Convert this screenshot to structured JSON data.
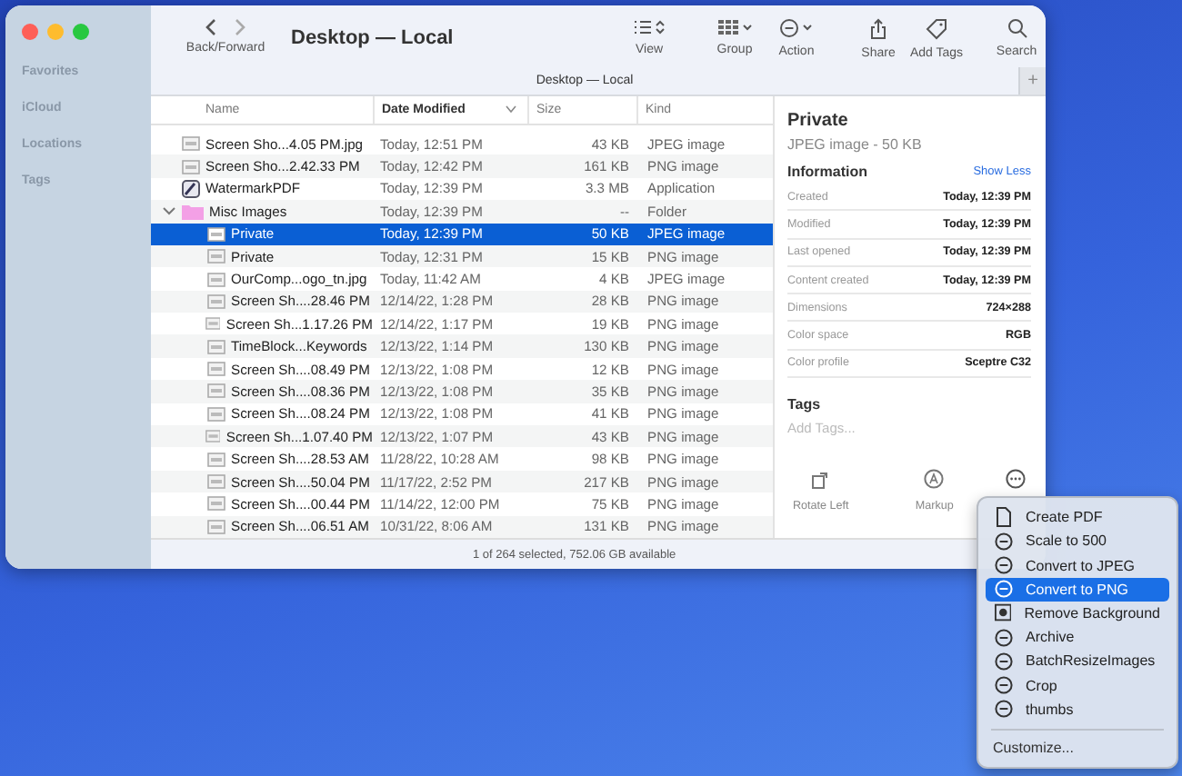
{
  "sidebar": {
    "items": [
      {
        "label": "Favorites"
      },
      {
        "label": "iCloud"
      },
      {
        "label": "Locations"
      },
      {
        "label": "Tags"
      }
    ]
  },
  "toolbar": {
    "nav_label": "Back/Forward",
    "title": "Desktop — Local",
    "items": [
      {
        "label": "View"
      },
      {
        "label": "Group"
      },
      {
        "label": "Action"
      },
      {
        "label": "Share"
      },
      {
        "label": "Add Tags"
      },
      {
        "label": "Search"
      }
    ]
  },
  "tab_bar": {
    "tab": "Desktop — Local",
    "add_button": "+"
  },
  "table": {
    "columns": [
      {
        "label": "Name",
        "sorted": false
      },
      {
        "label": "Date Modified",
        "sorted": true
      },
      {
        "label": "Size",
        "sorted": false
      },
      {
        "label": "Kind",
        "sorted": false
      }
    ],
    "rows": [
      {
        "kind": "file",
        "name": "Screen Sho...4.05 PM.jpg",
        "date": "Today, 12:51 PM",
        "size": "43 KB",
        "type": "JPEG image",
        "selected": false
      },
      {
        "kind": "file",
        "name": "Screen Sho...2.42.33 PM",
        "date": "Today, 12:42 PM",
        "size": "161 KB",
        "type": "PNG image",
        "selected": false
      },
      {
        "kind": "app",
        "name": "WatermarkPDF",
        "date": "Today, 12:39 PM",
        "size": "3.3 MB",
        "type": "Application",
        "selected": false
      },
      {
        "kind": "folder",
        "name": "Misc Images",
        "date": "Today, 12:39 PM",
        "size": "--",
        "type": "Folder",
        "selected": false,
        "expanded": true,
        "children": [
          {
            "kind": "file",
            "name": "Private",
            "date": "Today, 12:39 PM",
            "size": "50 KB",
            "type": "JPEG image",
            "selected": true
          },
          {
            "kind": "file",
            "name": "Private",
            "date": "Today, 12:31 PM",
            "size": "15 KB",
            "type": "PNG image",
            "selected": false
          },
          {
            "kind": "file",
            "name": "OurComp...ogo_tn.jpg",
            "date": "Today, 11:42 AM",
            "size": "4 KB",
            "type": "JPEG image",
            "selected": false
          },
          {
            "kind": "file",
            "name": "Screen Sh....28.46 PM",
            "date": "12/14/22, 1:28 PM",
            "size": "28 KB",
            "type": "PNG image",
            "selected": false
          },
          {
            "kind": "file",
            "name": "Screen Sh...1.17.26 PM",
            "date": "12/14/22, 1:17 PM",
            "size": "19 KB",
            "type": "PNG image",
            "selected": false
          },
          {
            "kind": "file",
            "name": "TimeBlock...Keywords",
            "date": "12/13/22, 1:14 PM",
            "size": "130 KB",
            "type": "PNG image",
            "selected": false
          },
          {
            "kind": "file",
            "name": "Screen Sh....08.49 PM",
            "date": "12/13/22, 1:08 PM",
            "size": "12 KB",
            "type": "PNG image",
            "selected": false
          },
          {
            "kind": "file",
            "name": "Screen Sh....08.36 PM",
            "date": "12/13/22, 1:08 PM",
            "size": "35 KB",
            "type": "PNG image",
            "selected": false
          },
          {
            "kind": "file",
            "name": "Screen Sh....08.24 PM",
            "date": "12/13/22, 1:08 PM",
            "size": "41 KB",
            "type": "PNG image",
            "selected": false
          },
          {
            "kind": "file",
            "name": "Screen Sh...1.07.40 PM",
            "date": "12/13/22, 1:07 PM",
            "size": "43 KB",
            "type": "PNG image",
            "selected": false
          },
          {
            "kind": "file",
            "name": "Screen Sh....28.53 AM",
            "date": "11/28/22, 10:28 AM",
            "size": "98 KB",
            "type": "PNG image",
            "selected": false
          },
          {
            "kind": "file",
            "name": "Screen Sh....50.04 PM",
            "date": "11/17/22, 2:52 PM",
            "size": "217 KB",
            "type": "PNG image",
            "selected": false
          },
          {
            "kind": "file",
            "name": "Screen Sh....00.44 PM",
            "date": "11/14/22, 12:00 PM",
            "size": "75 KB",
            "type": "PNG image",
            "selected": false
          },
          {
            "kind": "file",
            "name": "Screen Sh....06.51 AM",
            "date": "10/31/22, 8:06 AM",
            "size": "131 KB",
            "type": "PNG image",
            "selected": false
          }
        ]
      }
    ]
  },
  "status_bar": "1 of 264 selected, 752.06 GB available",
  "preview": {
    "title": "Private",
    "subtitle": "JPEG image - 50 KB",
    "section": "Information",
    "toggle": "Show Less",
    "info": [
      {
        "label": "Created",
        "value": "Today, 12:39 PM"
      },
      {
        "label": "Modified",
        "value": "Today, 12:39 PM"
      },
      {
        "label": "Last opened",
        "value": "Today, 12:39 PM"
      },
      {
        "label": "Content created",
        "value": "Today, 12:39 PM"
      },
      {
        "label": "Dimensions",
        "value": "724×288"
      },
      {
        "label": "Color space",
        "value": "RGB"
      },
      {
        "label": "Color profile",
        "value": "Sceptre C32"
      }
    ],
    "tags_heading": "Tags",
    "tags_placeholder": "Add Tags...",
    "actions": [
      {
        "kind": "rotate",
        "label": "Rotate Left"
      },
      {
        "kind": "markup",
        "label": "Markup"
      },
      {
        "kind": "more"
      }
    ]
  },
  "menu": {
    "items": [
      {
        "kind": "doc",
        "label": "Create PDF",
        "selected": false
      },
      {
        "kind": "action",
        "label": "Scale to 500",
        "selected": false
      },
      {
        "kind": "action",
        "label": "Convert to JPEG",
        "selected": false
      },
      {
        "kind": "action",
        "label": "Convert to PNG",
        "selected": true
      },
      {
        "kind": "removebg",
        "label": "Remove Background",
        "selected": false
      },
      {
        "kind": "action",
        "label": "Archive",
        "selected": false
      },
      {
        "kind": "action",
        "label": "BatchResizeImages",
        "selected": false
      },
      {
        "kind": "action",
        "label": "Crop",
        "selected": false
      },
      {
        "kind": "action",
        "label": "thumbs",
        "selected": false
      }
    ],
    "footer": "Customize..."
  }
}
